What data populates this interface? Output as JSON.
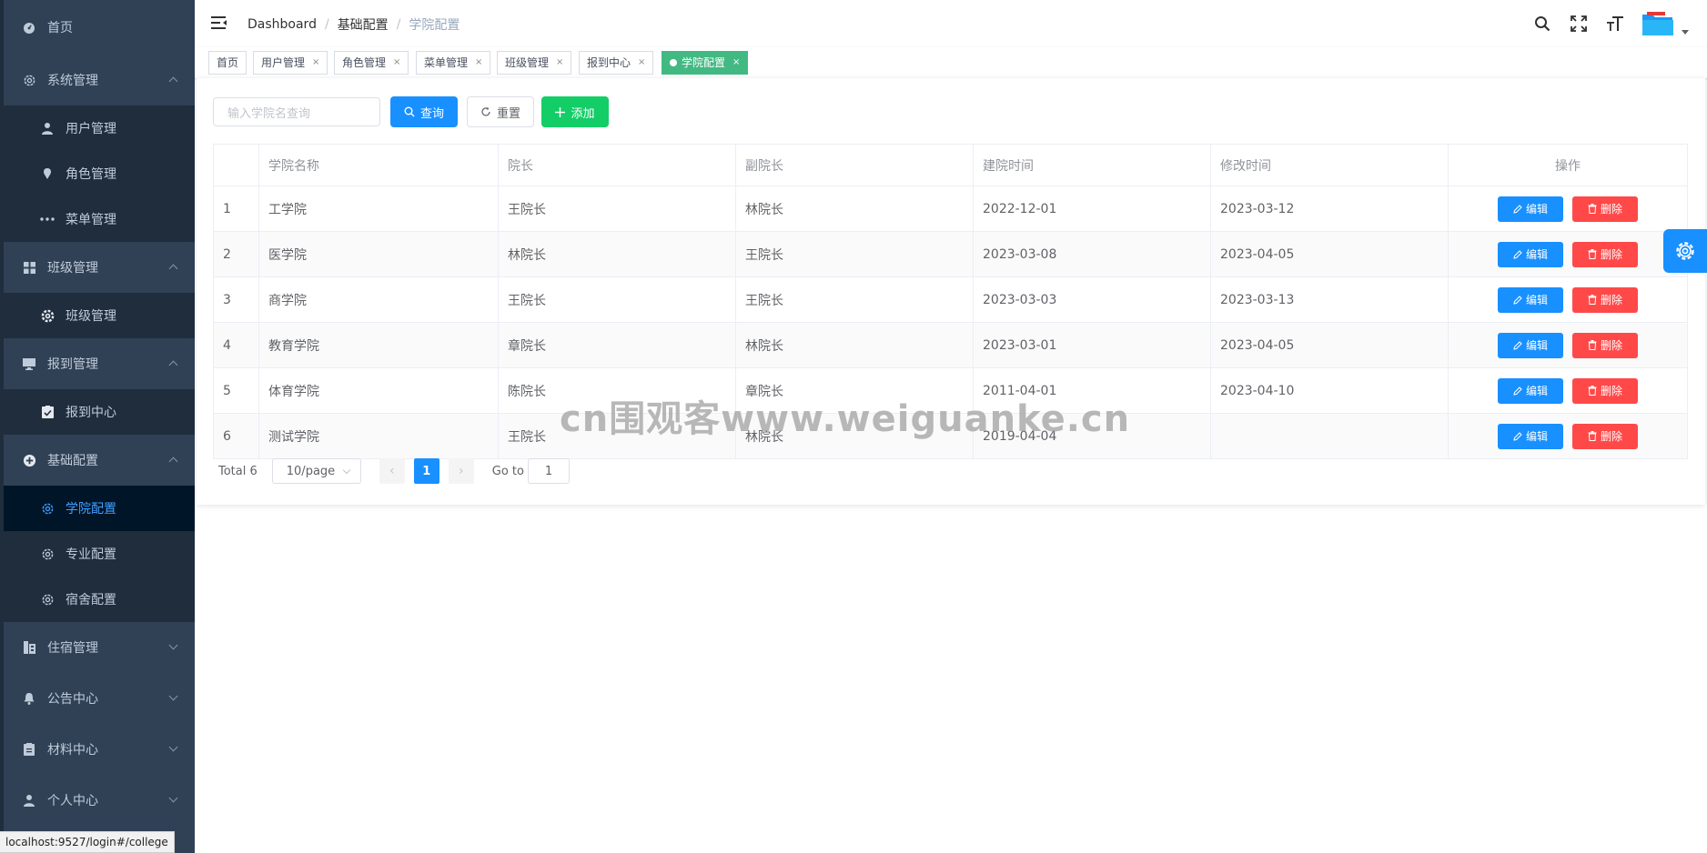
{
  "sidebar": {
    "items": [
      {
        "label": "首页",
        "icon": "dashboard-icon"
      },
      {
        "label": "系统管理",
        "icon": "gear-icon",
        "expanded": true,
        "children": [
          {
            "label": "用户管理",
            "icon": "user-icon"
          },
          {
            "label": "角色管理",
            "icon": "peoples-icon"
          },
          {
            "label": "菜单管理",
            "icon": "more-icon"
          }
        ]
      },
      {
        "label": "班级管理",
        "icon": "grid-icon",
        "expanded": true,
        "children": [
          {
            "label": "班级管理",
            "icon": "cog-icon"
          }
        ]
      },
      {
        "label": "报到管理",
        "icon": "monitor-icon",
        "expanded": true,
        "children": [
          {
            "label": "报到中心",
            "icon": "checklist-icon"
          }
        ]
      },
      {
        "label": "基础配置",
        "icon": "add-circle-icon",
        "expanded": true,
        "children": [
          {
            "label": "学院配置",
            "icon": "gear-icon",
            "active": true
          },
          {
            "label": "专业配置",
            "icon": "gear-icon"
          },
          {
            "label": "宿舍配置",
            "icon": "gear-icon"
          }
        ]
      },
      {
        "label": "住宿管理",
        "icon": "building-icon",
        "expanded": false
      },
      {
        "label": "公告中心",
        "icon": "bell-icon",
        "expanded": false
      },
      {
        "label": "材料中心",
        "icon": "clipboard-icon",
        "expanded": false
      },
      {
        "label": "个人中心",
        "icon": "user-icon",
        "expanded": false
      }
    ]
  },
  "navbar": {
    "breadcrumb": [
      "Dashboard",
      "基础配置",
      "学院配置"
    ]
  },
  "tags": [
    {
      "label": "首页",
      "closable": false
    },
    {
      "label": "用户管理",
      "closable": true
    },
    {
      "label": "角色管理",
      "closable": true
    },
    {
      "label": "菜单管理",
      "closable": true
    },
    {
      "label": "班级管理",
      "closable": true
    },
    {
      "label": "报到中心",
      "closable": true
    },
    {
      "label": "学院配置",
      "closable": true,
      "active": true
    }
  ],
  "toolbar": {
    "search_placeholder": "输入学院名查询",
    "query_label": "查询",
    "reset_label": "重置",
    "add_label": "添加"
  },
  "table": {
    "columns": [
      "",
      "学院名称",
      "院长",
      "副院长",
      "建院时间",
      "修改时间",
      "操作"
    ],
    "rows": [
      [
        "1",
        "工学院",
        "王院长",
        "林院长",
        "2022-12-01",
        "2023-03-12"
      ],
      [
        "2",
        "医学院",
        "林院长",
        "王院长",
        "2023-03-08",
        "2023-04-05"
      ],
      [
        "3",
        "商学院",
        "王院长",
        "王院长",
        "2023-03-03",
        "2023-03-13"
      ],
      [
        "4",
        "教育学院",
        "章院长",
        "林院长",
        "2023-03-01",
        "2023-04-05"
      ],
      [
        "5",
        "体育学院",
        "陈院长",
        "章院长",
        "2011-04-01",
        "2023-04-10"
      ],
      [
        "6",
        "测试学院",
        "王院长",
        "林院长",
        "2019-04-04",
        ""
      ]
    ],
    "edit_label": "编辑",
    "delete_label": "删除"
  },
  "pagination": {
    "total_text": "Total 6",
    "page_size": "10/page",
    "current_page": "1",
    "goto_label": "Go to",
    "goto_value": "1"
  },
  "watermark": "cn围观客www.weiguanke.cn",
  "statusbar": {
    "url": "localhost:9527/login#/college"
  },
  "colors": {
    "sidebar_bg": "#304156",
    "primary": "#1890ff",
    "success": "#13ce66",
    "danger": "#ff4949",
    "tag_active": "#42b983"
  }
}
